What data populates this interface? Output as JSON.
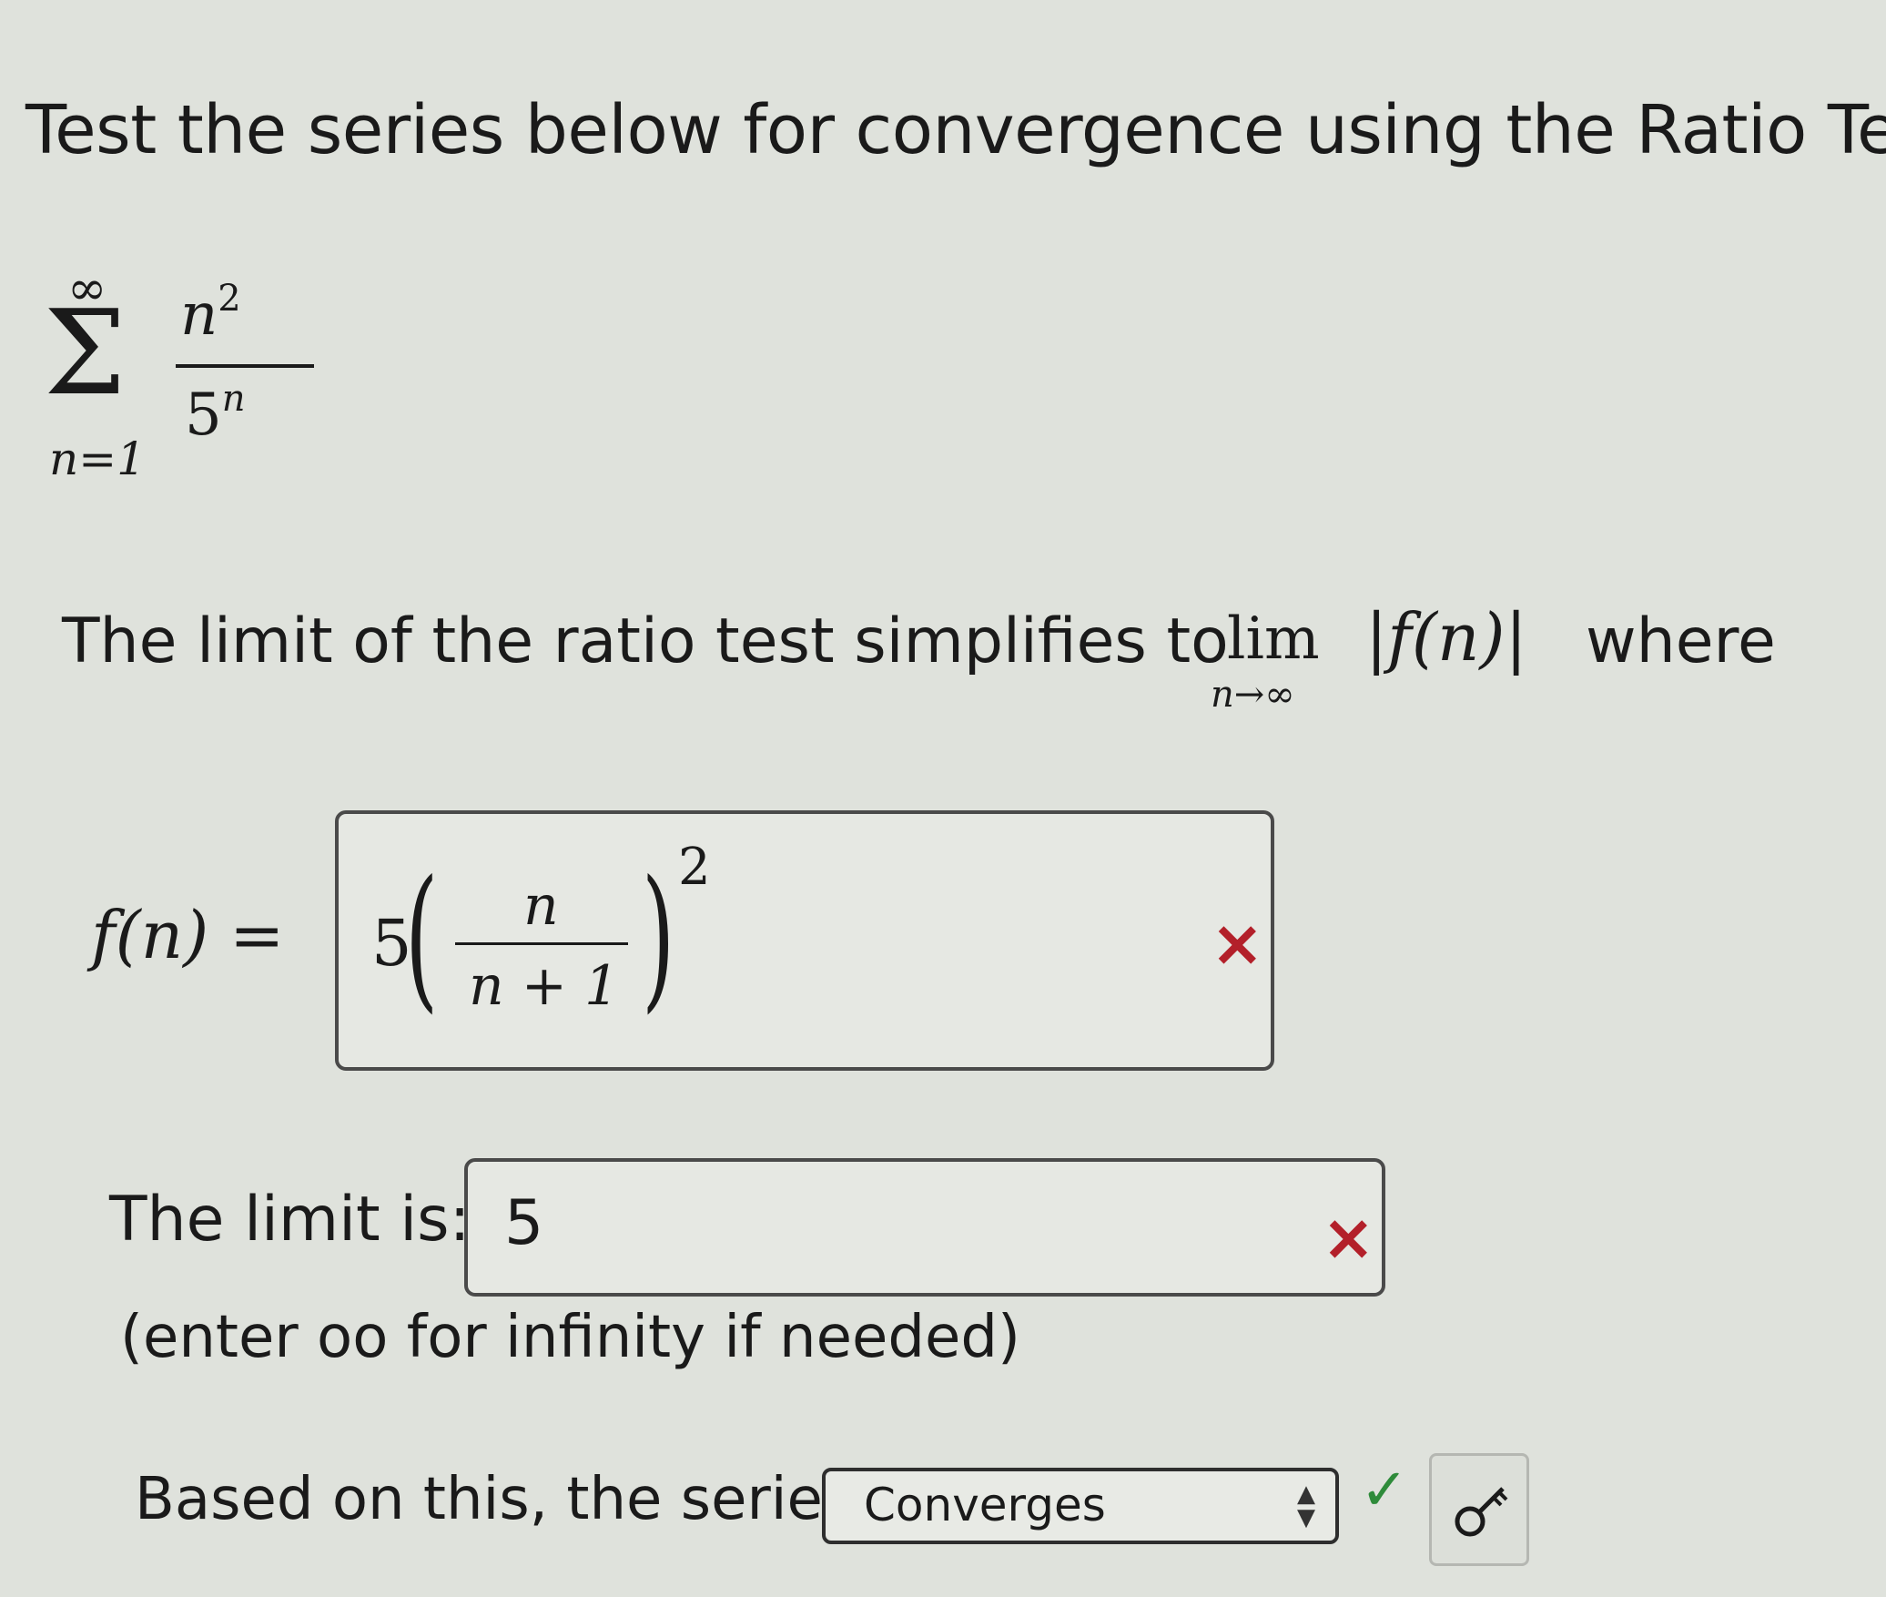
{
  "question": {
    "prompt": "Test the series below for convergence using the Ratio Test."
  },
  "series": {
    "symbol": "Σ",
    "upper": "∞",
    "lower": "n=1",
    "numerator": "n",
    "numerator_exp": "2",
    "denominator": "5",
    "denominator_exp": "n"
  },
  "ratio_sentence": {
    "text": "The limit of the ratio test simplifies to",
    "lim": "lim",
    "lim_sub": "n→∞",
    "abs_expr": "|f(n)|",
    "suffix": "where"
  },
  "fn_row": {
    "label": "f(n) =",
    "answer": {
      "coef": "5",
      "num": "n",
      "den": "n + 1",
      "exp": "2"
    },
    "status": "incorrect",
    "status_icon": "×"
  },
  "limit_row": {
    "label": "The limit is:",
    "value": "5",
    "status": "incorrect",
    "status_icon": "×",
    "hint": "(enter oo for infinity if needed)"
  },
  "conclusion_row": {
    "label": "Based on this, the series",
    "selected": "Converges",
    "status": "correct",
    "status_icon": "✓",
    "key_icon": "key-icon"
  },
  "colors": {
    "incorrect": "#b3202a",
    "correct": "#2e8b3a"
  }
}
